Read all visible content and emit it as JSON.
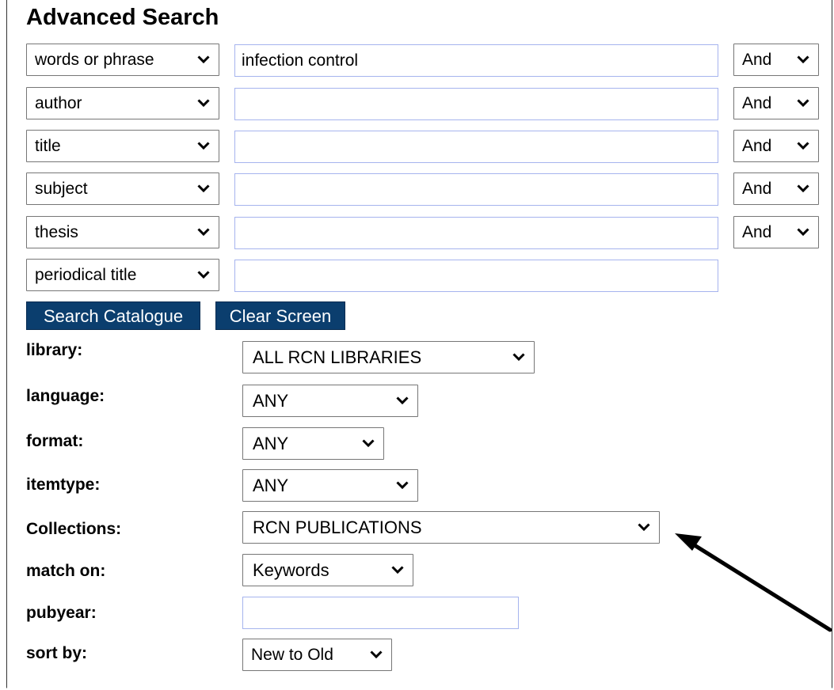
{
  "page": {
    "title": "Advanced Search"
  },
  "search_rows": [
    {
      "field": "words or phrase",
      "value": "infection control",
      "bool": "And"
    },
    {
      "field": "author",
      "value": "",
      "bool": "And"
    },
    {
      "field": "title",
      "value": "",
      "bool": "And"
    },
    {
      "field": "subject",
      "value": "",
      "bool": "And"
    },
    {
      "field": "thesis",
      "value": "",
      "bool": "And"
    },
    {
      "field": "periodical title",
      "value": ""
    }
  ],
  "buttons": {
    "search": "Search Catalogue",
    "clear": "Clear Screen"
  },
  "limits": {
    "library": {
      "label": "library:",
      "value": "ALL RCN LIBRARIES"
    },
    "language": {
      "label": "language:",
      "value": "ANY"
    },
    "format": {
      "label": "format:",
      "value": "ANY"
    },
    "itemtype": {
      "label": "itemtype:",
      "value": "ANY"
    },
    "collections": {
      "label": "Collections:",
      "value": "RCN PUBLICATIONS"
    },
    "match_on": {
      "label": "match on:",
      "value": "Keywords"
    },
    "pubyear": {
      "label": "pubyear:",
      "value": ""
    },
    "sort_by": {
      "label": "sort by:",
      "value": "New to Old"
    }
  },
  "colors": {
    "button_bg": "#0b3e6e",
    "input_border": "#a6b4ee",
    "arrow": "#000000"
  },
  "icons": [
    "chevron-down-icon",
    "annotation-arrow"
  ]
}
